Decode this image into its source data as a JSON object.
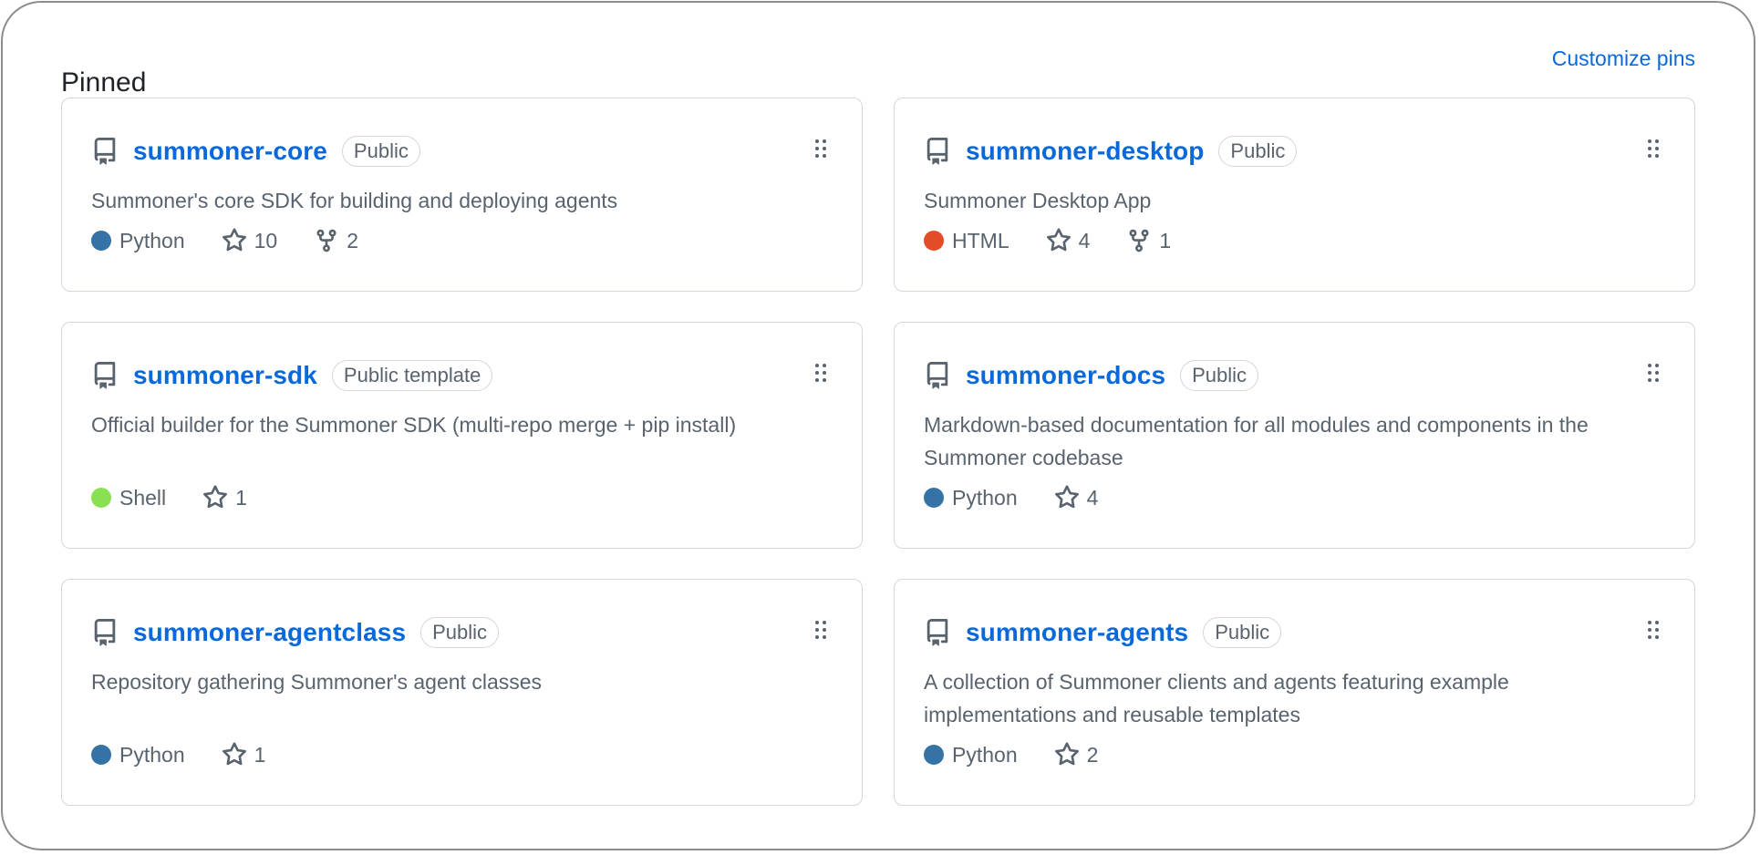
{
  "header": {
    "title": "Pinned",
    "customize_label": "Customize pins"
  },
  "colors": {
    "link": "#0969da",
    "Python": "#3572A5",
    "HTML": "#e34c26",
    "Shell": "#89e051"
  },
  "repos": [
    {
      "name": "summoner-core",
      "visibility": "Public",
      "description": "Summoner's core SDK for building and deploying agents",
      "language": "Python",
      "language_color": "#3572A5",
      "stars": "10",
      "forks": "2"
    },
    {
      "name": "summoner-desktop",
      "visibility": "Public",
      "description": "Summoner Desktop App",
      "language": "HTML",
      "language_color": "#e34c26",
      "stars": "4",
      "forks": "1"
    },
    {
      "name": "summoner-sdk",
      "visibility": "Public template",
      "description": "Official builder for the Summoner SDK (multi-repo merge + pip install)",
      "language": "Shell",
      "language_color": "#89e051",
      "stars": "1"
    },
    {
      "name": "summoner-docs",
      "visibility": "Public",
      "description": "Markdown-based documentation for all modules and components in the Summoner codebase",
      "language": "Python",
      "language_color": "#3572A5",
      "stars": "4"
    },
    {
      "name": "summoner-agentclass",
      "visibility": "Public",
      "description": "Repository gathering Summoner's agent classes",
      "language": "Python",
      "language_color": "#3572A5",
      "stars": "1"
    },
    {
      "name": "summoner-agents",
      "visibility": "Public",
      "description": "A collection of Summoner clients and agents featuring example implementations and reusable templates",
      "language": "Python",
      "language_color": "#3572A5",
      "stars": "2"
    }
  ]
}
